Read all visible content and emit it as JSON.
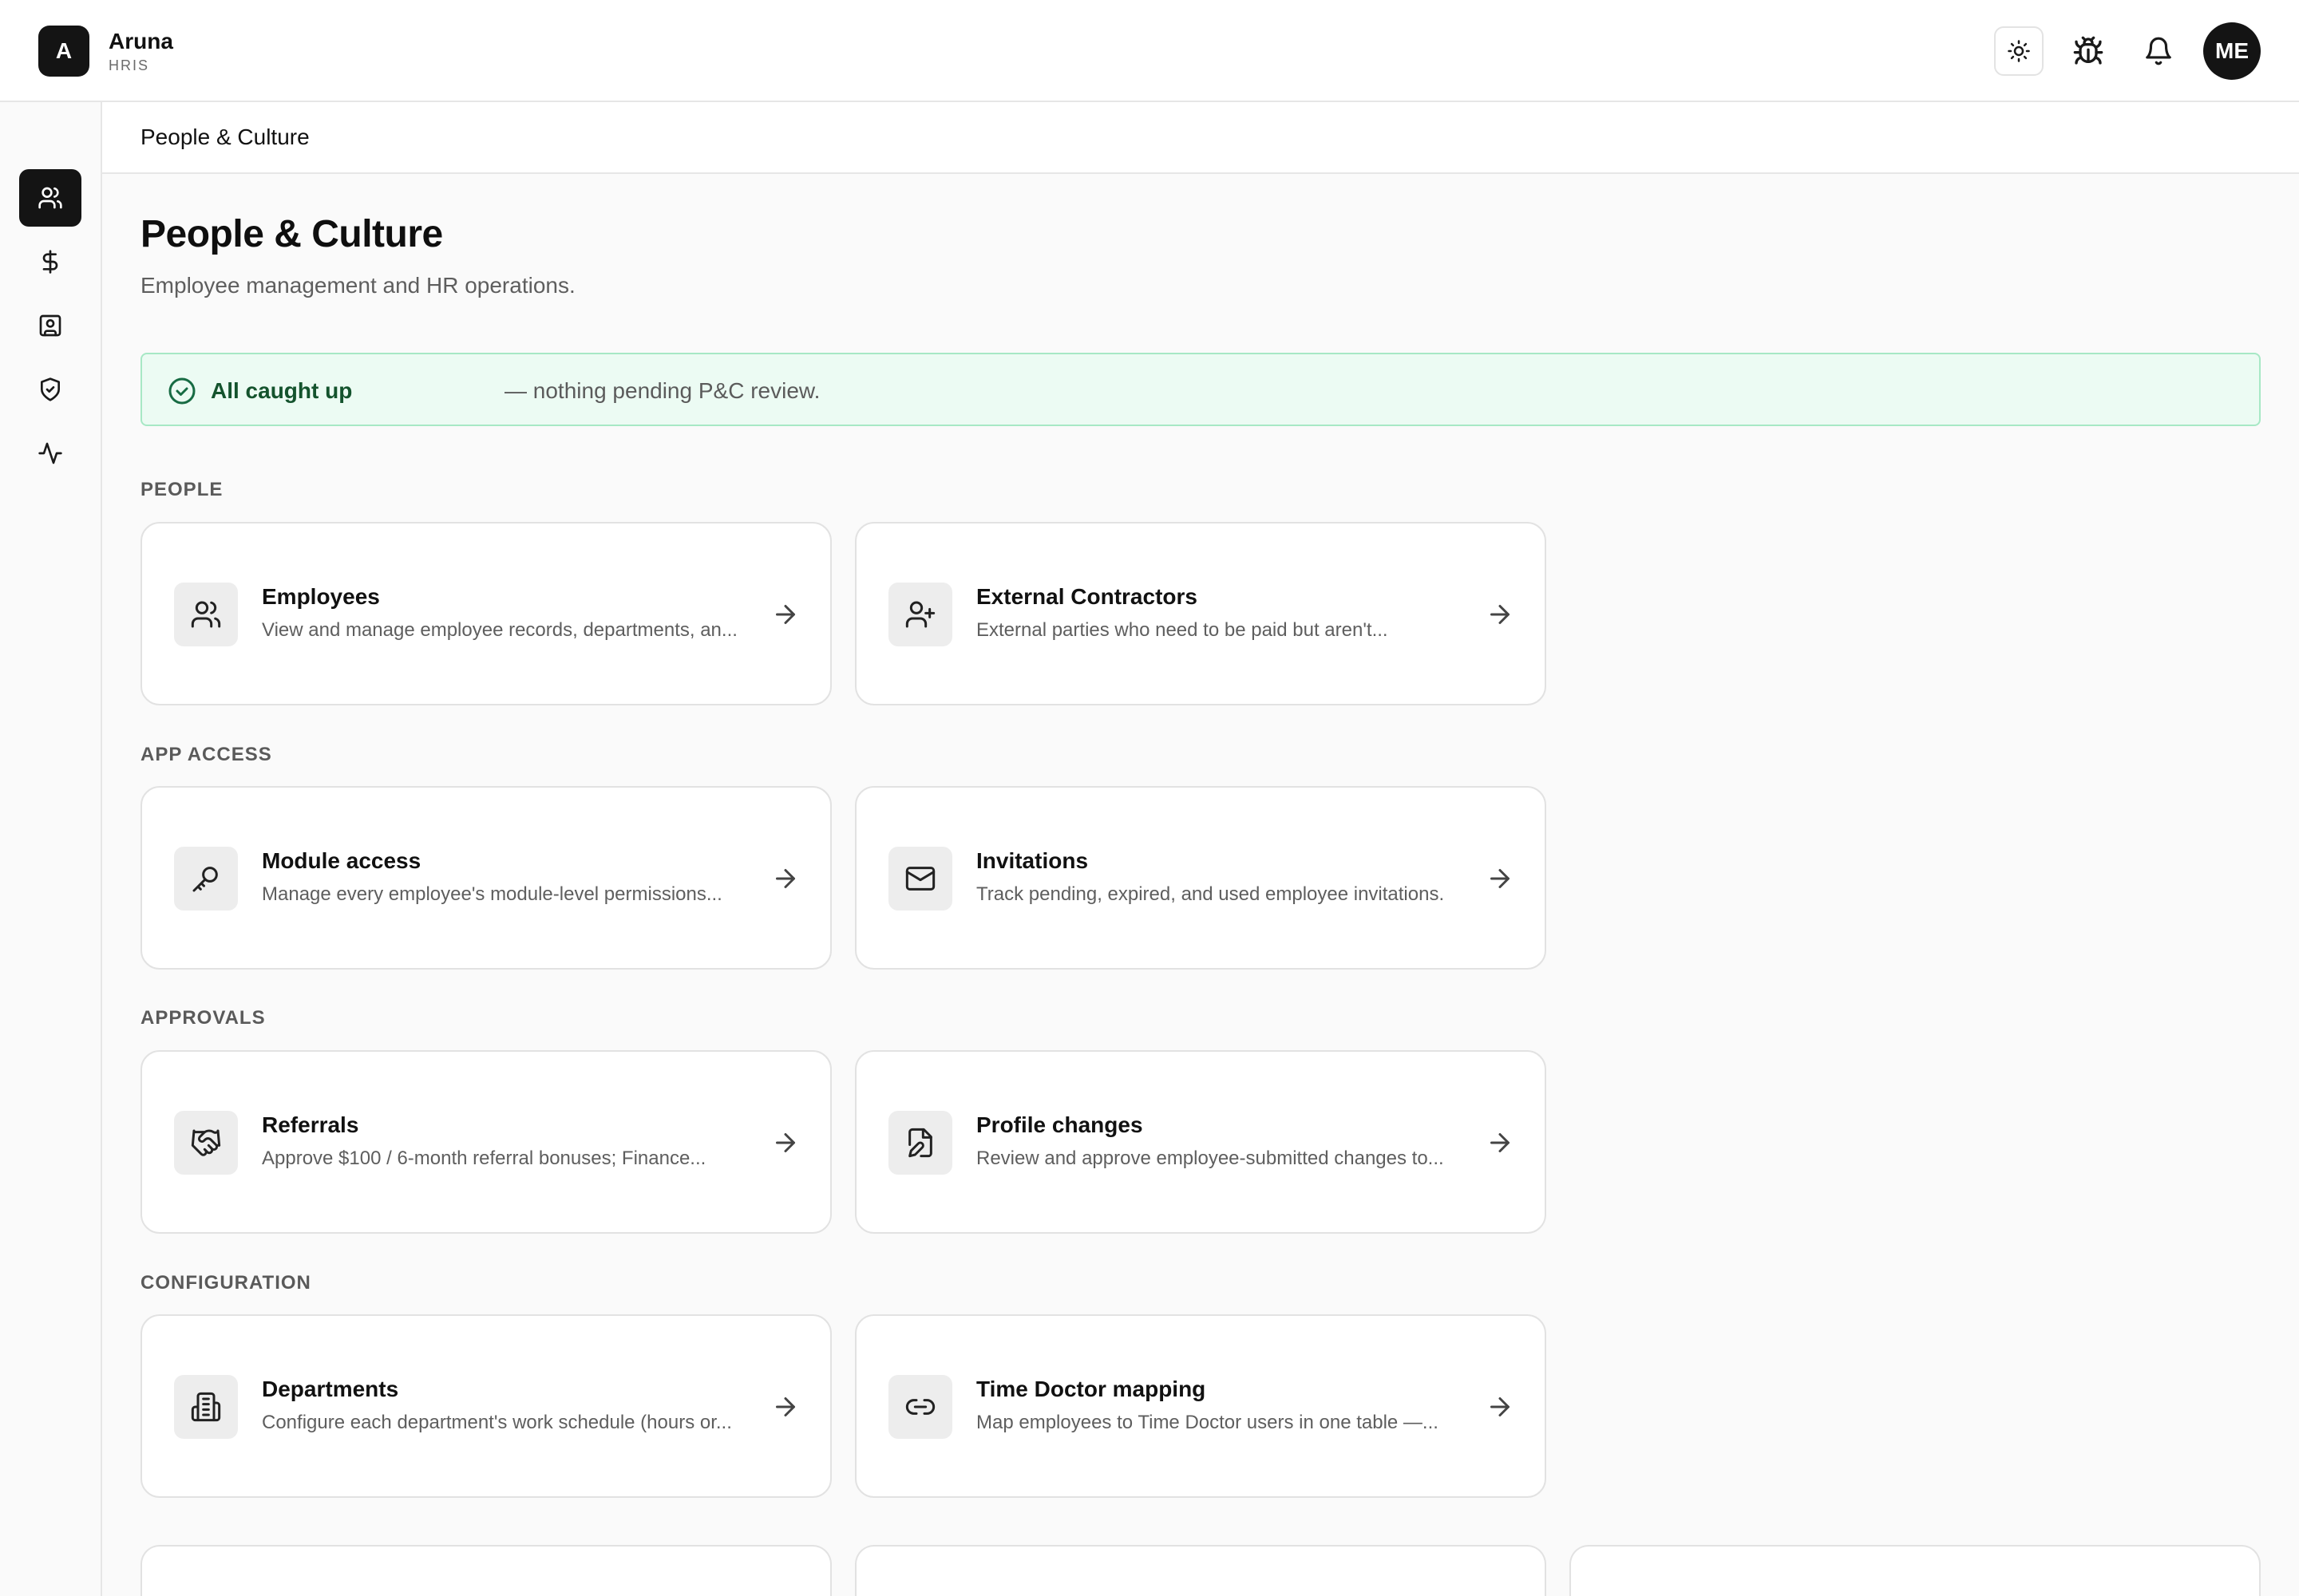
{
  "app": {
    "logo_letter": "A",
    "name": "Aruna",
    "subtitle": "HRIS"
  },
  "header": {
    "actions": [
      {
        "name": "theme-toggle-button",
        "icon": "sun-icon"
      },
      {
        "name": "bug-report-button",
        "icon": "bug-icon"
      },
      {
        "name": "notifications-button",
        "icon": "bell-icon"
      }
    ],
    "avatar_initials": "ME"
  },
  "sidebar": {
    "items": [
      {
        "icon": "users-icon",
        "active": true
      },
      {
        "icon": "dollar-icon",
        "active": false
      },
      {
        "icon": "id-card-icon",
        "active": false
      },
      {
        "icon": "shield-check-icon",
        "active": false
      },
      {
        "icon": "activity-icon",
        "active": false
      }
    ]
  },
  "breadcrumb": "People & Culture",
  "page": {
    "title": "People & Culture",
    "subtitle": "Employee management and HR operations."
  },
  "banner": {
    "strong": "All caught up",
    "rest": "— nothing pending P&C review.",
    "color": "#14532d"
  },
  "sections": [
    {
      "label": "PEOPLE",
      "cards": [
        {
          "title": "Employees",
          "description": "View and manage employee records, departments, an...",
          "icon": "users-icon"
        },
        {
          "title": "External Contractors",
          "description": "External parties who need to be paid but aren't...",
          "icon": "user-plus-icon"
        }
      ]
    },
    {
      "label": "APP ACCESS",
      "cards": [
        {
          "title": "Module access",
          "description": "Manage every employee's module-level permissions...",
          "icon": "key-icon"
        },
        {
          "title": "Invitations",
          "description": "Track pending, expired, and used employee invitations.",
          "icon": "mail-icon"
        }
      ]
    },
    {
      "label": "APPROVALS",
      "cards": [
        {
          "title": "Referrals",
          "description": "Approve $100 / 6-month referral bonuses; Finance...",
          "icon": "handshake-icon"
        },
        {
          "title": "Profile changes",
          "description": "Review and approve employee-submitted changes to...",
          "icon": "file-edit-icon"
        }
      ]
    },
    {
      "label": "CONFIGURATION",
      "cards": [
        {
          "title": "Departments",
          "description": "Configure each department's work schedule (hours or...",
          "icon": "building-icon"
        },
        {
          "title": "Time Doctor mapping",
          "description": "Map employees to Time Doctor users in one table —...",
          "icon": "link-icon"
        }
      ]
    }
  ]
}
